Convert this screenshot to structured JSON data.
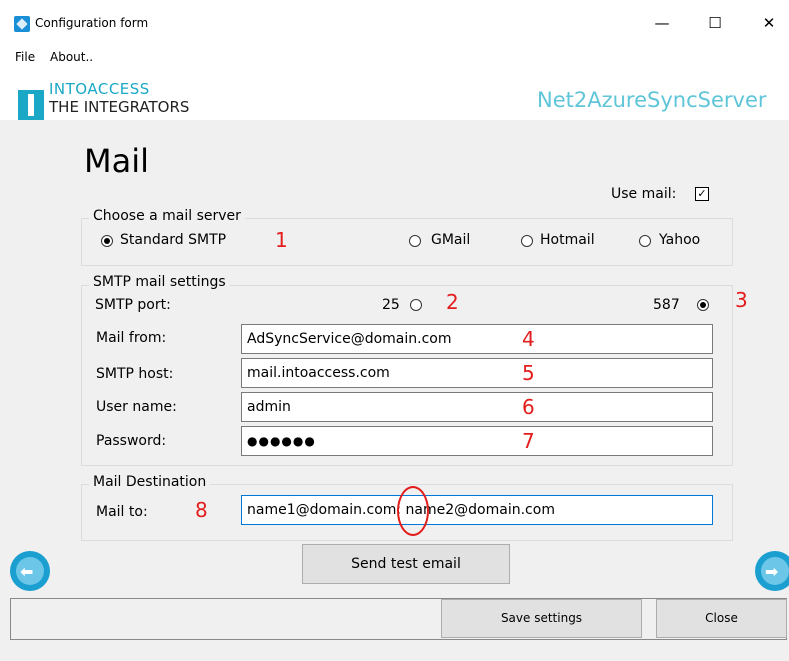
{
  "window": {
    "title": "Configuration form",
    "minimize": "—",
    "maximize": "☐",
    "close": "✕"
  },
  "menu": {
    "file": "File",
    "about": "About.."
  },
  "banner": {
    "brand_line1": "INTOACCESS",
    "brand_line2": "THE INTEGRATORS",
    "app_name": "Net2AzureSyncServer"
  },
  "page": {
    "title": "Mail"
  },
  "use_mail": {
    "label": "Use mail:",
    "checked": true,
    "mark": "✓"
  },
  "server_group": {
    "legend": "Choose a mail server",
    "options": [
      "Standard SMTP",
      "GMail",
      "Hotmail",
      "Yahoo"
    ],
    "selected": "Standard SMTP"
  },
  "smtp_group": {
    "legend": "SMTP mail settings",
    "port_label": "SMTP port:",
    "port_options": [
      "25",
      "587"
    ],
    "port_selected": "587",
    "mail_from_label": "Mail from:",
    "mail_from_value": "AdSyncService@domain.com",
    "host_label": "SMTP host:",
    "host_value": "mail.intoaccess.com",
    "user_label": "User name:",
    "user_value": "admin",
    "password_label": "Password:",
    "password_value": "●●●●●●"
  },
  "dest_group": {
    "legend": "Mail Destination",
    "mail_to_label": "Mail to:",
    "mail_to_value": "name1@domain.com; name2@domain.com"
  },
  "annotations": [
    "1",
    "2",
    "3",
    "4",
    "5",
    "6",
    "7",
    "8"
  ],
  "buttons": {
    "send_test": "Send test email",
    "save": "Save settings",
    "close": "Close"
  },
  "colors": {
    "accent": "#1aa8c6",
    "app_name": "#5fc5d8",
    "annotation": "#e31c1c",
    "focus": "#0078d7"
  }
}
